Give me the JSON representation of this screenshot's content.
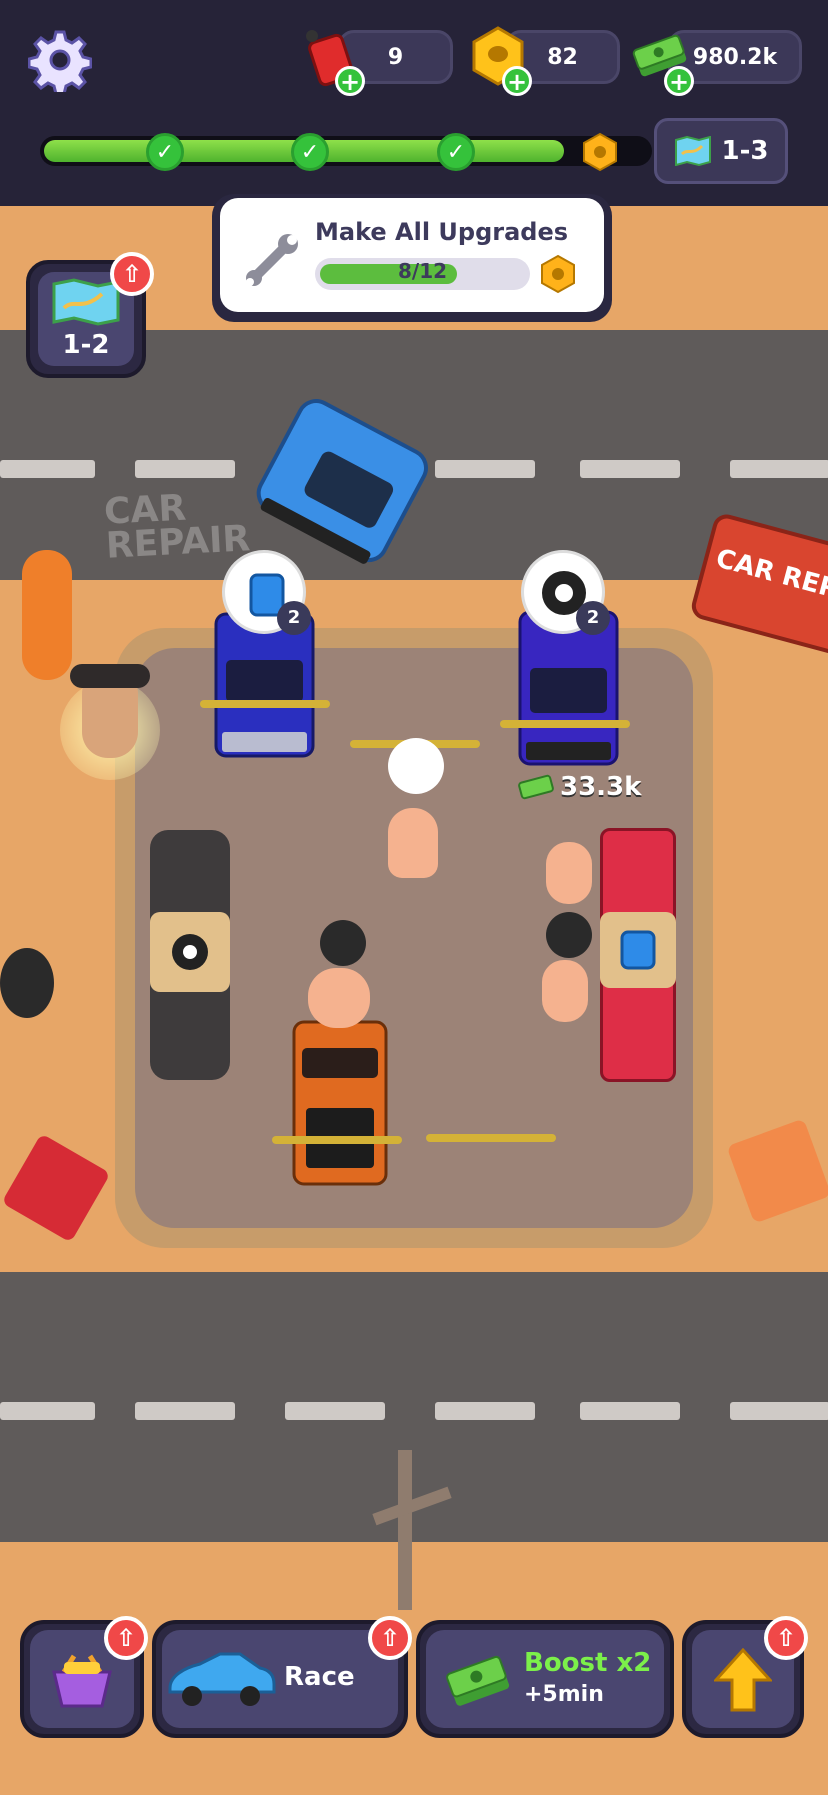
{
  "hud": {
    "fuel_count": "9",
    "nuts_count": "82",
    "cash_count": "980.2k",
    "current_level": "1-3"
  },
  "task": {
    "title": "Make All Upgrades",
    "progress_text": "8/12",
    "progress": 0.667
  },
  "map_button": {
    "label": "1-2"
  },
  "scene": {
    "sign_ground": "CAR\nREPAIR",
    "sign_board": "CAR REPAI",
    "left_bay_badge": "2",
    "right_bay_badge": "2",
    "earned_cash": "33.3k"
  },
  "bottom": {
    "race_label": "Race",
    "boost_label": "Boost x2",
    "boost_sub": "+5min"
  },
  "colors": {
    "accent_green": "#35c23b",
    "hud_bg": "#262338",
    "badge_red": "#f04848"
  }
}
